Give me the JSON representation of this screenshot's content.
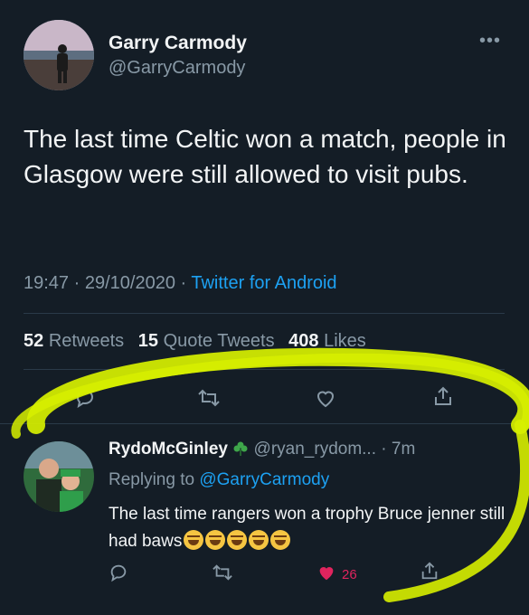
{
  "tweet": {
    "author_name": "Garry Carmody",
    "author_handle": "@GarryCarmody",
    "more_label": "•••",
    "text": "The last time Celtic won a match, people in Glasgow were still allowed to visit pubs.",
    "time": "19:47",
    "date": "29/10/2020",
    "source": "Twitter for Android",
    "retweets": "52",
    "retweets_label": "Retweets",
    "quote_tweets": "15",
    "quote_tweets_label": "Quote Tweets",
    "likes": "408",
    "likes_label": "Likes"
  },
  "reply": {
    "author_name": "RydoMcGinley",
    "badge_icon": "shamrock-icon",
    "author_handle": "@ryan_rydom...",
    "time_ago": "7m",
    "replying_prefix": "Replying to",
    "replying_to": "@GarryCarmody",
    "text": "The last time rangers won a trophy Bruce jenner still had baws",
    "emoji_count": 5,
    "like_count": "26"
  },
  "colors": {
    "background": "#141d26",
    "link": "#1da1f2",
    "secondary": "#8899a6",
    "like": "#e0245e",
    "highlighter": "#d7f000"
  },
  "icons": [
    "reply-icon",
    "retweet-icon",
    "like-icon",
    "share-icon"
  ]
}
